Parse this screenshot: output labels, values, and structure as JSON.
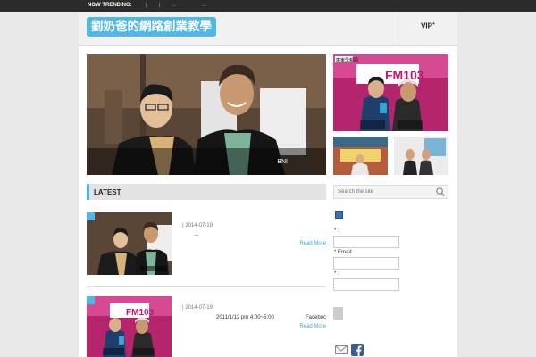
{
  "trending": {
    "label": "NOW TRENDING:",
    "separators": [
      "|",
      "|",
      "...",
      "..."
    ]
  },
  "header": {
    "logo_text": "劉奶爸的網路創業教學",
    "vip_label": "VIP",
    "vip_mark": "+"
  },
  "hero": {
    "caption": "BNI"
  },
  "latest": {
    "title": "LATEST"
  },
  "search": {
    "placeholder": "Search the site"
  },
  "posts": [
    {
      "date": "|   2014-07-19",
      "excerpt": "...",
      "more": "Read More"
    },
    {
      "date": "|   2014-07-19",
      "excerpt": "2011/1/12        pm 4:00~5:00",
      "excerpt_tail": "Faceboc",
      "more": "Read More"
    }
  ],
  "form": {
    "label1": "*              :",
    "label2": "*        Email:",
    "label3": "*              :"
  },
  "side_badge": "廣東早報訊",
  "fm_label": "FM103",
  "colors": {
    "accent": "#4fb8e7",
    "trend_bar": "#2b2b2b",
    "link": "#3aa3d4"
  },
  "icons": [
    "search-icon",
    "mail-icon",
    "facebook-icon"
  ]
}
